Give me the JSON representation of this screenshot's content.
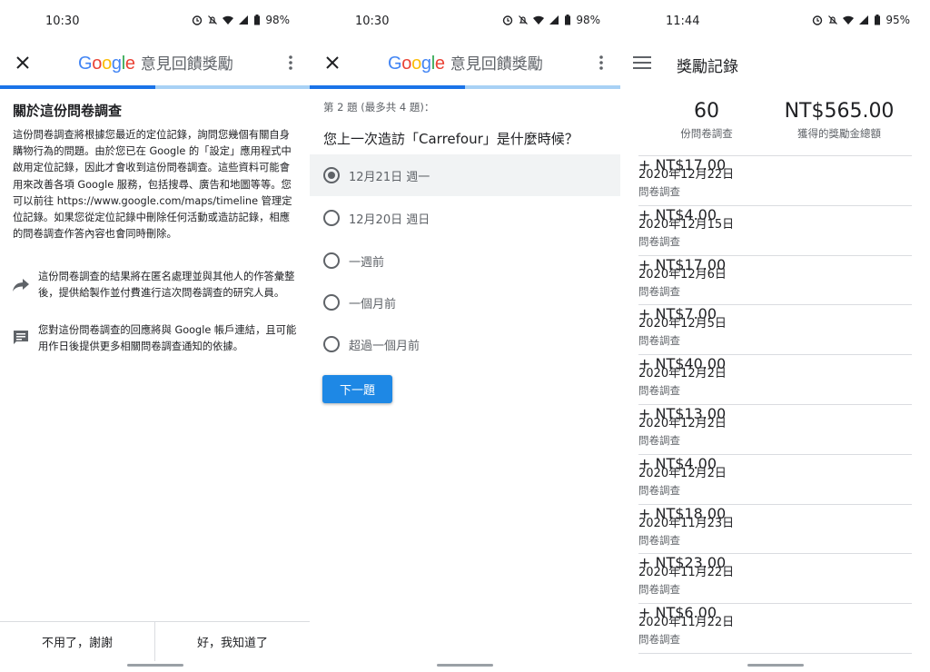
{
  "panel1": {
    "status": {
      "time": "10:30",
      "battery": "98%"
    },
    "brand": {
      "google": "Google",
      "subtitle": "意見回饋獎勵"
    },
    "progress": 0.5,
    "title": "關於這份問卷調查",
    "body": "這份問卷調查將根據您最近的定位記錄，詢問您幾個有關自身購物行為的問題。由於您已在 Google 的「設定」應用程式中啟用定位記錄，因此才會收到這份問卷調查。這些資料可能會用來改善各項 Google 服務，包括搜尋、廣告和地圖等等。您可以前往 https://www.google.com/maps/timeline 管理定位記錄。如果您從定位記錄中刪除任何活動或造訪記錄，相應的問卷調查作答內容也會同時刪除。",
    "info_share": "這份問卷調查的結果將在匿名處理並與其他人的作答彙整後，提供給製作並付費進行這次問卷調查的研究人員。",
    "info_account": "您對這份問卷調查的回應將與 Google 帳戶連結，且可能用作日後提供更多相關問卷調查通知的依據。",
    "decline": "不用了，謝謝",
    "accept": "好，我知道了"
  },
  "panel2": {
    "status": {
      "time": "10:30",
      "battery": "98%"
    },
    "brand": {
      "google": "Google",
      "subtitle": "意見回饋獎勵"
    },
    "progress": 0.5,
    "question_number": "第 2 題 (最多共 4 題)：",
    "question": "您上一次造訪「Carrefour」是什麼時候？",
    "options": [
      "12月21日 週一",
      "12月20日 週日",
      "一週前",
      "一個月前",
      "超過一個月前"
    ],
    "selected_index": 0,
    "next": "下一題"
  },
  "panel3": {
    "status": {
      "time": "11:44",
      "battery": "95%"
    },
    "title": "獎勵記錄",
    "surveys_count": "60",
    "surveys_label": "份問卷調查",
    "total_amount": "NT$565.00",
    "total_label": "獲得的獎勵金總額",
    "rewards": [
      {
        "date": "2020年12月22日",
        "kind": "問卷調查",
        "amount": "+ NT$17.00"
      },
      {
        "date": "2020年12月15日",
        "kind": "問卷調查",
        "amount": "+ NT$4.00"
      },
      {
        "date": "2020年12月6日",
        "kind": "問卷調查",
        "amount": "+ NT$17.00"
      },
      {
        "date": "2020年12月5日",
        "kind": "問卷調查",
        "amount": "+ NT$7.00"
      },
      {
        "date": "2020年12月2日",
        "kind": "問卷調查",
        "amount": "+ NT$40.00"
      },
      {
        "date": "2020年12月2日",
        "kind": "問卷調查",
        "amount": "+ NT$13.00"
      },
      {
        "date": "2020年12月2日",
        "kind": "問卷調查",
        "amount": "+ NT$4.00"
      },
      {
        "date": "2020年11月23日",
        "kind": "問卷調查",
        "amount": "+ NT$18.00"
      },
      {
        "date": "2020年11月22日",
        "kind": "問卷調查",
        "amount": "+ NT$23.00"
      },
      {
        "date": "2020年11月22日",
        "kind": "問卷調查",
        "amount": "+ NT$6.00"
      }
    ]
  },
  "colors": {
    "google_blue": "#4285f4",
    "accent": "#1a73e8",
    "button": "#1e88e5",
    "reward_green": "#34a853"
  }
}
